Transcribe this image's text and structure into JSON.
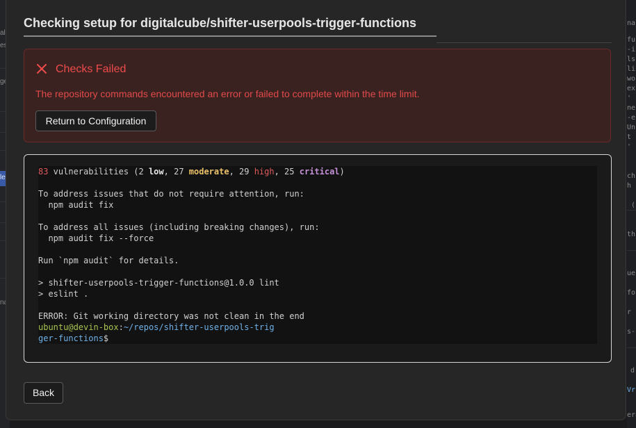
{
  "dialog": {
    "title": "Checking setup for digitalcube/shifter-userpools-trigger-functions",
    "back_label": "Back"
  },
  "error": {
    "title": "Checks Failed",
    "message": "The repository commands encountered an error or failed to complete within the time limit.",
    "button_label": "Return to Configuration",
    "icon": "close-icon",
    "color": "#ef4b4b"
  },
  "terminal": {
    "audit_summary": {
      "total": "83",
      "label": " vulnerabilities (2 ",
      "low": "low",
      "sep1": ", 27 ",
      "moderate": "moderate",
      "sep2": ", 29 ",
      "high": "high",
      "sep3": ", 25 ",
      "critical": "critical",
      "end": ")"
    },
    "lines": [
      "To address issues that do not require attention, run:",
      "  npm audit fix",
      "To address all issues (including breaking changes), run:",
      "  npm audit fix --force",
      "Run `npm audit` for details.",
      "> shifter-userpools-trigger-functions@1.0.0 lint",
      "> eslint .",
      "ERROR: Git working directory was not clean in the end"
    ],
    "prompt": {
      "user_host": "ubuntu@devin-box",
      "colon": ":",
      "path_part1": "~/repos/shifter-userpools-trig",
      "path_part2": "ger-functions",
      "symbol": "$"
    }
  },
  "background": {
    "left_fragments": [
      "al",
      "es",
      "ge",
      "le",
      "na"
    ],
    "right_fragments": [
      "na",
      "fu",
      "-i",
      "ls",
      "li",
      "wo",
      "ex",
      "'",
      "ne",
      "-e",
      "Un",
      "t",
      "'",
      "ch",
      "h",
      "(",
      "th",
      "ue",
      "fo",
      "r",
      "s-",
      "d",
      "Vr",
      "era"
    ]
  }
}
